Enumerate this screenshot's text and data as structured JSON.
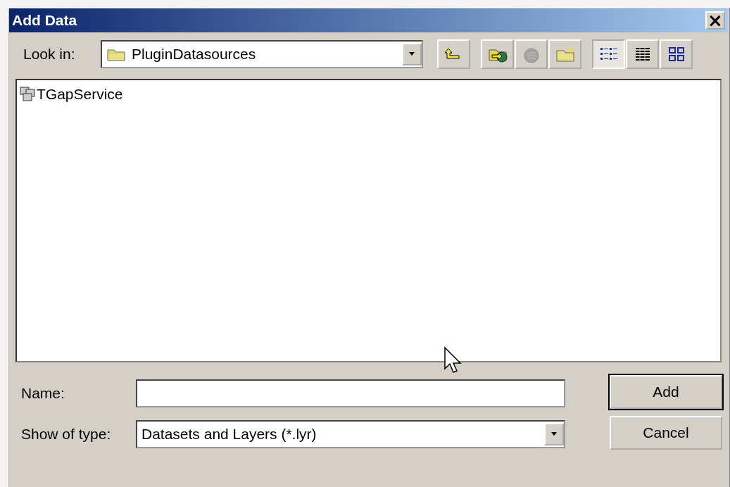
{
  "window": {
    "title": "Add Data",
    "close": "×"
  },
  "look_in": {
    "label": "Look in:",
    "value": "PluginDatasources"
  },
  "tools": [
    {
      "kind": "up",
      "disabled": false
    },
    {
      "kind": "connect",
      "disabled": false
    },
    {
      "kind": "disconnect",
      "disabled": true
    },
    {
      "kind": "newfolder",
      "disabled": false
    }
  ],
  "views": [
    {
      "kind": "list",
      "selected": true
    },
    {
      "kind": "details",
      "selected": false
    },
    {
      "kind": "thumbnails",
      "selected": false
    }
  ],
  "items": [
    {
      "name": "TGapService",
      "selected": false
    }
  ],
  "name_field": {
    "label": "Name:"
  },
  "type_field": {
    "label": "Show of type:",
    "value": "Datasets and Layers (*.lyr)"
  },
  "buttons": [
    {
      "label": "Add",
      "default": true
    },
    {
      "label": "Cancel",
      "default": false
    }
  ]
}
